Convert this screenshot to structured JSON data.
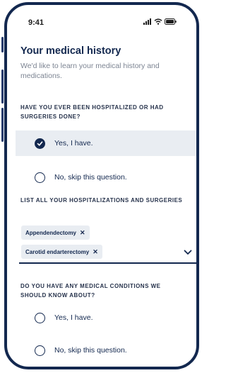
{
  "status": {
    "time": "9:41"
  },
  "header": {
    "title": "Your medical history",
    "subtitle": "We'd like to learn your medical history and medications."
  },
  "question_hospitalized": {
    "label": "HAVE YOU EVER BEEN HOSPITALIZED OR HAD SURGERIES DONE?",
    "options": [
      {
        "label": "Yes, I have.",
        "selected": true
      },
      {
        "label": "No, skip this question.",
        "selected": false
      }
    ]
  },
  "surgeries": {
    "label": "LIST ALL YOUR HOSPITALIZATIONS AND SURGERIES",
    "chips": [
      "Appendendectomy",
      "Carotid endarterectomy"
    ],
    "remove_glyph": "✕"
  },
  "question_conditions": {
    "label": "DO YOU HAVE ANY MEDICAL CONDITIONS WE SHOULD KNOW ABOUT?",
    "options": [
      {
        "label": "Yes, I have.",
        "selected": false
      },
      {
        "label": "No, skip this question.",
        "selected": false
      }
    ]
  },
  "colors": {
    "navy": "#13284f",
    "selected_background": "#e9edf2",
    "subtitle_gray": "#7c8492"
  },
  "icons": [
    "signal-icon",
    "wifi-icon",
    "battery-icon",
    "check-icon",
    "remove-icon",
    "chevron-down-icon"
  ]
}
